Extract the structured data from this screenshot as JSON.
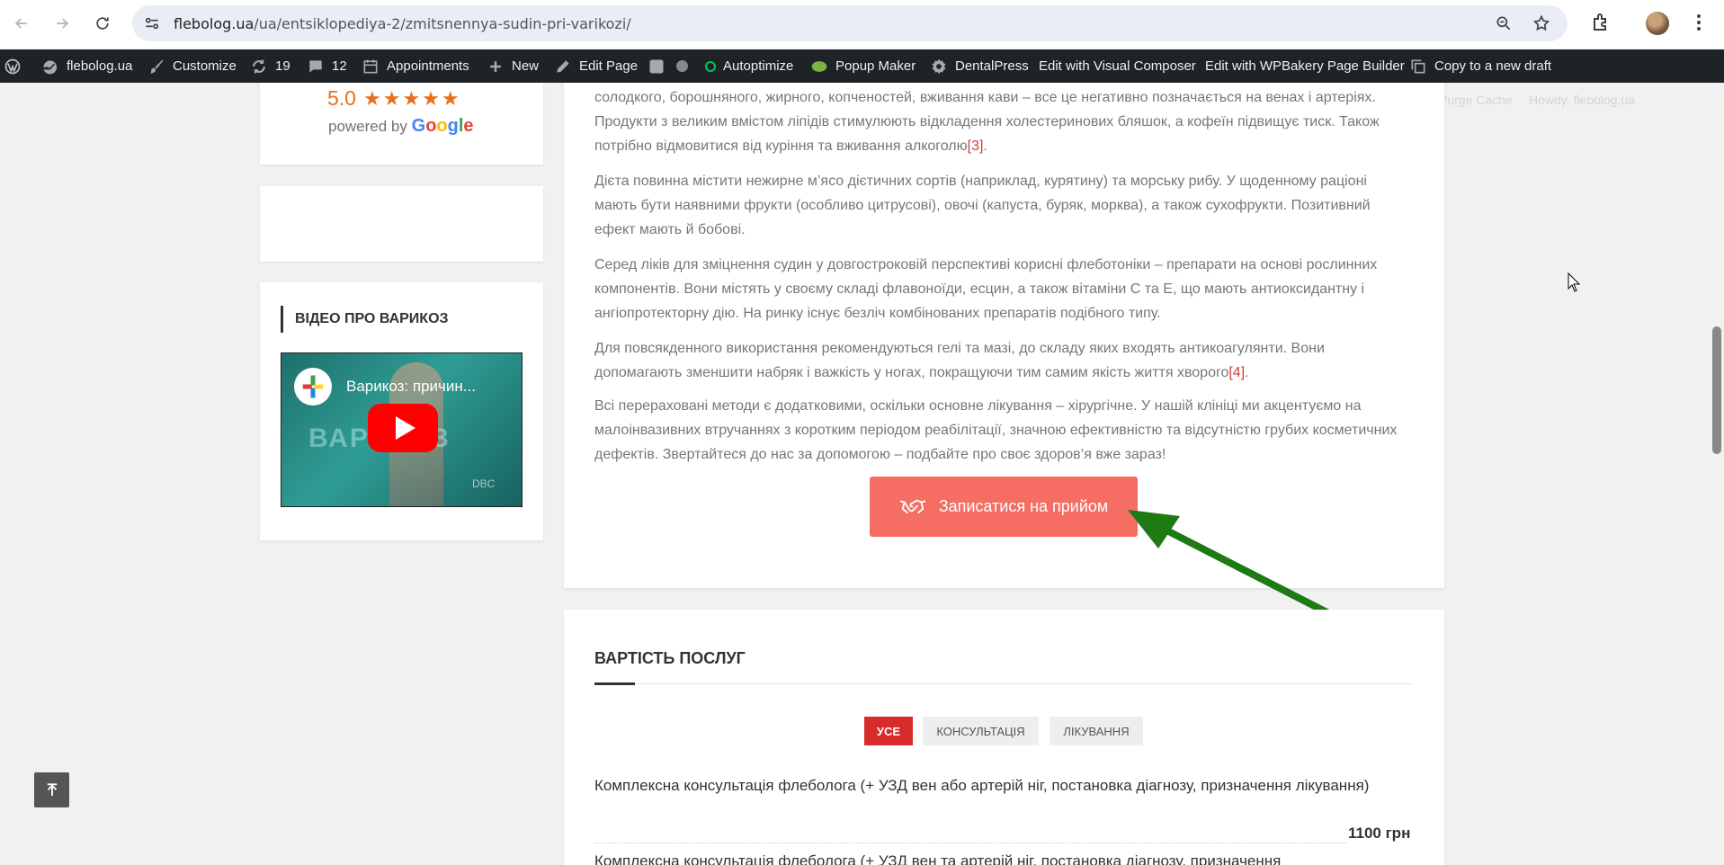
{
  "browser": {
    "url_domain": "flebolog.ua",
    "url_path": "/ua/entsiklopediya-2/zmitsnennya-sudin-pri-varikozi/"
  },
  "admin_bar": {
    "site": "flebolog.ua",
    "customize": "Customize",
    "updates_count": "19",
    "comments_count": "12",
    "appointments": "Appointments",
    "new": "New",
    "edit_page": "Edit Page",
    "autoptimize": "Autoptimize",
    "popup_maker": "Popup Maker",
    "dentalpress": "DentalPress",
    "visual_composer": "Edit with Visual Composer",
    "wpbakery": "Edit with WPBakery Page Builder",
    "copy_draft": "Copy to a new draft",
    "purge_cache": "Purge Cache",
    "howdy": "Howdy, flebolog.ua"
  },
  "sidebar": {
    "rating_value": "5.0",
    "rating_stars": "★★★★★",
    "powered_by": "powered by",
    "google": "Google",
    "video_heading": "ВІДЕО ПРО ВАРИКОЗ",
    "video_title": "Варикоз: причин...",
    "video_big_text": "ВАРИКОЗ",
    "video_watermark": "DBC"
  },
  "article": {
    "p1_text": "солодкого, борошняного, жирного, копченостей, вживання кави – все це негативно позначається на венах і артеріях. Продукти з великим вмістом ліпідів стимулюють відкладення холестеринових бляшок, а кофеїн підвищує тиск. Також потрібно відмовитися від куріння та вживання алкоголю",
    "p1_ref": "[3]",
    "p2": "Дієта повинна містити нежирне м’ясо дієтичних сортів (наприклад, курятину) та морську рибу. У щоденному раціоні мають бути наявними фрукти (особливо цитрусові), овочі (капуста, буряк, морква), а також сухофрукти. Позитивний ефект мають й бобові.",
    "p3": "Серед ліків для зміцнення судин у довгостроковій перспективі корисні флеботоніки – препарати на основі рослинних компонентів. Вони містять у своєму складі флавоноїди, есцин, а також вітаміни С та Е, що мають антиоксидантну і ангіопротекторну дію. На ринку існує безліч комбінованих препаратів подібного типу.",
    "p4_text": "Для повсякденного використання рекомендуються гелі та мазі, до складу яких входять антикоагулянти. Вони допомагають зменшити набряк і важкість у ногах, покращуючи тим самим якість життя хворого",
    "p4_ref": "[4]",
    "p4_end": ".",
    "p5": "Всі перераховані методи є додатковими, оскільки основне лікування – хірургічне. У нашій клініці ми акцентуємо на малоінвазивних втручаннях з коротким періодом реабілітації, значною ефективністю та відсутністю грубих косметичних дефектів. Звертайтеся до нас за допомогою – подбайте про своє здоров’я вже зараз!",
    "button_label": "Записатися на прийом"
  },
  "prices": {
    "heading": "ВАРТІСТЬ ПОСЛУГ",
    "tabs": [
      "УСЕ",
      "КОНСУЛЬТАЦІЯ",
      "ЛІКУВАННЯ"
    ],
    "items": [
      {
        "name": "Комплексна консультація флеболога (+ УЗД вен або артерій ніг, постановка діагнозу, призначення лікування)",
        "price": "1100 грн"
      },
      {
        "name": "Комплексна консультація флеболога (+ УЗД вен та артерій ніг, постановка діагнозу, призначення"
      }
    ]
  },
  "colors": {
    "accent_red": "#d82c2c",
    "button_coral": "#f56d63",
    "arrow_green": "#1e7a12",
    "admin_bar": "#1d2327"
  }
}
